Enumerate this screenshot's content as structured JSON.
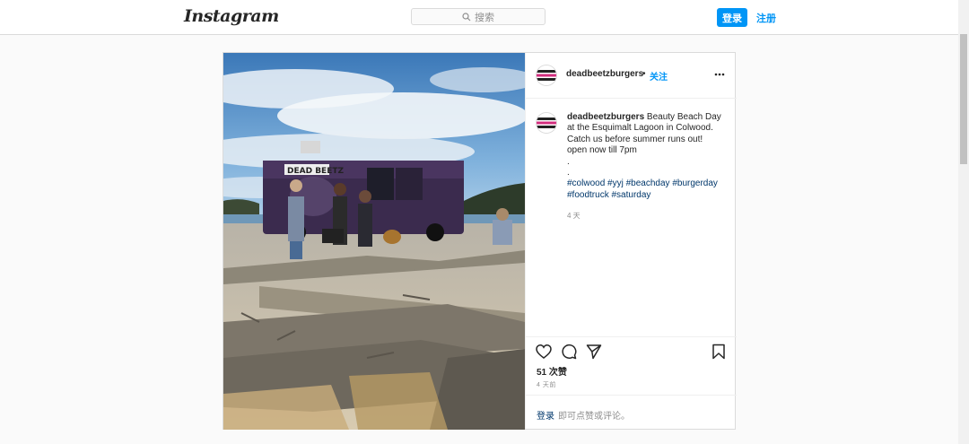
{
  "header": {
    "logo_text": "Instagram",
    "search_placeholder": "搜索",
    "login_label": "登录",
    "signup_label": "注册"
  },
  "post": {
    "image_alt": "Dead Beetz food truck at Esquimalt Lagoon beach with driftwood",
    "username": "deadbeetzburgers",
    "separator": "•",
    "follow_label": "关注",
    "caption": {
      "username": "deadbeetzburgers",
      "text_lines": [
        "Beauty Beach Day",
        "at the Esquimalt Lagoon in Colwood.",
        "Catch us before summer runs out!",
        "open now till 7pm",
        ".",
        "."
      ],
      "hashtags": [
        "#colwood",
        "#yyj",
        "#beachday",
        "#burgerday",
        "#foodtruck",
        "#saturday"
      ]
    },
    "caption_time": "4 天",
    "likes": "51 次赞",
    "posted_time": "4 天前",
    "comment_login": "登录",
    "comment_hint": "即可点赞或评论。"
  },
  "colors": {
    "accent": "#0095f6",
    "hashtag": "#00376b",
    "border": "#dbdbdb",
    "background": "#fafafa"
  },
  "icons": {
    "search": "search-icon",
    "more": "more-options-icon",
    "like": "heart-icon",
    "comment": "comment-icon",
    "share": "share-icon",
    "save": "bookmark-icon"
  }
}
